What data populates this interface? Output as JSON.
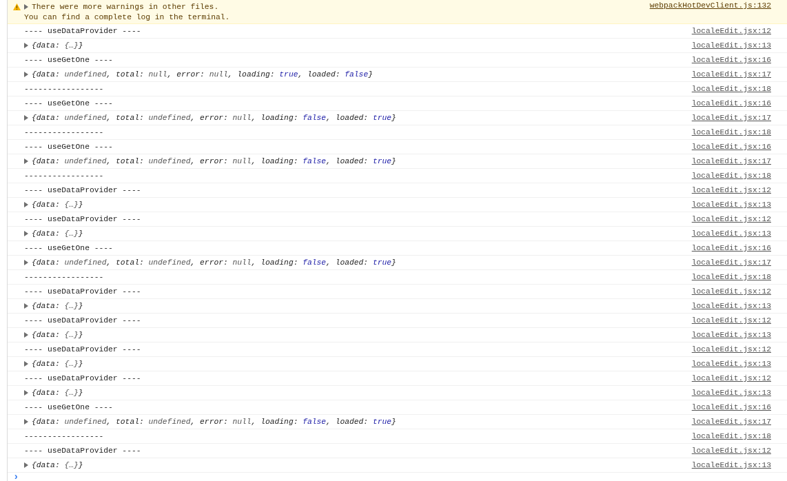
{
  "warning": {
    "expanded": false,
    "lines": [
      "There were more warnings in other files.",
      "You can find a complete log in the terminal."
    ],
    "source": "webpackHotDevClient.js:132"
  },
  "log": [
    {
      "kind": "text",
      "text": "---- useDataProvider ----",
      "source": "localeEdit.jsx:12"
    },
    {
      "kind": "object",
      "expanded": false,
      "parts": [
        {
          "text": "{data: ",
          "kind": "key"
        },
        {
          "text": "{…}",
          "kind": "value"
        },
        {
          "text": "}",
          "kind": "key"
        }
      ],
      "source": "localeEdit.jsx:13"
    },
    {
      "kind": "text",
      "text": "---- useGetOne ----",
      "source": "localeEdit.jsx:16"
    },
    {
      "kind": "object",
      "expanded": false,
      "parts": [
        {
          "text": "{data: ",
          "kind": "key"
        },
        {
          "text": "undefined",
          "kind": "value"
        },
        {
          "text": ", total: ",
          "kind": "key"
        },
        {
          "text": "null",
          "kind": "value"
        },
        {
          "text": ", error: ",
          "kind": "key"
        },
        {
          "text": "null",
          "kind": "value"
        },
        {
          "text": ", loading: ",
          "kind": "key"
        },
        {
          "text": "true",
          "kind": "boolean"
        },
        {
          "text": ", loaded: ",
          "kind": "key"
        },
        {
          "text": "false",
          "kind": "boolean"
        },
        {
          "text": "}",
          "kind": "key"
        }
      ],
      "source": "localeEdit.jsx:17"
    },
    {
      "kind": "text",
      "text": "-----------------",
      "source": "localeEdit.jsx:18"
    },
    {
      "kind": "text",
      "text": "---- useGetOne ----",
      "source": "localeEdit.jsx:16"
    },
    {
      "kind": "object",
      "expanded": false,
      "parts": [
        {
          "text": "{data: ",
          "kind": "key"
        },
        {
          "text": "undefined",
          "kind": "value"
        },
        {
          "text": ", total: ",
          "kind": "key"
        },
        {
          "text": "undefined",
          "kind": "value"
        },
        {
          "text": ", error: ",
          "kind": "key"
        },
        {
          "text": "null",
          "kind": "value"
        },
        {
          "text": ", loading: ",
          "kind": "key"
        },
        {
          "text": "false",
          "kind": "boolean"
        },
        {
          "text": ", loaded: ",
          "kind": "key"
        },
        {
          "text": "true",
          "kind": "boolean"
        },
        {
          "text": "}",
          "kind": "key"
        }
      ],
      "source": "localeEdit.jsx:17"
    },
    {
      "kind": "text",
      "text": "-----------------",
      "source": "localeEdit.jsx:18"
    },
    {
      "kind": "text",
      "text": "---- useGetOne ----",
      "source": "localeEdit.jsx:16"
    },
    {
      "kind": "object",
      "expanded": false,
      "parts": [
        {
          "text": "{data: ",
          "kind": "key"
        },
        {
          "text": "undefined",
          "kind": "value"
        },
        {
          "text": ", total: ",
          "kind": "key"
        },
        {
          "text": "undefined",
          "kind": "value"
        },
        {
          "text": ", error: ",
          "kind": "key"
        },
        {
          "text": "null",
          "kind": "value"
        },
        {
          "text": ", loading: ",
          "kind": "key"
        },
        {
          "text": "false",
          "kind": "boolean"
        },
        {
          "text": ", loaded: ",
          "kind": "key"
        },
        {
          "text": "true",
          "kind": "boolean"
        },
        {
          "text": "}",
          "kind": "key"
        }
      ],
      "source": "localeEdit.jsx:17"
    },
    {
      "kind": "text",
      "text": "-----------------",
      "source": "localeEdit.jsx:18"
    },
    {
      "kind": "text",
      "text": "---- useDataProvider ----",
      "source": "localeEdit.jsx:12"
    },
    {
      "kind": "object",
      "expanded": false,
      "parts": [
        {
          "text": "{data: ",
          "kind": "key"
        },
        {
          "text": "{…}",
          "kind": "value"
        },
        {
          "text": "}",
          "kind": "key"
        }
      ],
      "source": "localeEdit.jsx:13"
    },
    {
      "kind": "text",
      "text": "---- useDataProvider ----",
      "source": "localeEdit.jsx:12"
    },
    {
      "kind": "object",
      "expanded": false,
      "parts": [
        {
          "text": "{data: ",
          "kind": "key"
        },
        {
          "text": "{…}",
          "kind": "value"
        },
        {
          "text": "}",
          "kind": "key"
        }
      ],
      "source": "localeEdit.jsx:13"
    },
    {
      "kind": "text",
      "text": "---- useGetOne ----",
      "source": "localeEdit.jsx:16"
    },
    {
      "kind": "object",
      "expanded": false,
      "parts": [
        {
          "text": "{data: ",
          "kind": "key"
        },
        {
          "text": "undefined",
          "kind": "value"
        },
        {
          "text": ", total: ",
          "kind": "key"
        },
        {
          "text": "undefined",
          "kind": "value"
        },
        {
          "text": ", error: ",
          "kind": "key"
        },
        {
          "text": "null",
          "kind": "value"
        },
        {
          "text": ", loading: ",
          "kind": "key"
        },
        {
          "text": "false",
          "kind": "boolean"
        },
        {
          "text": ", loaded: ",
          "kind": "key"
        },
        {
          "text": "true",
          "kind": "boolean"
        },
        {
          "text": "}",
          "kind": "key"
        }
      ],
      "source": "localeEdit.jsx:17"
    },
    {
      "kind": "text",
      "text": "-----------------",
      "source": "localeEdit.jsx:18"
    },
    {
      "kind": "text",
      "text": "---- useDataProvider ----",
      "source": "localeEdit.jsx:12"
    },
    {
      "kind": "object",
      "expanded": false,
      "parts": [
        {
          "text": "{data: ",
          "kind": "key"
        },
        {
          "text": "{…}",
          "kind": "value"
        },
        {
          "text": "}",
          "kind": "key"
        }
      ],
      "source": "localeEdit.jsx:13"
    },
    {
      "kind": "text",
      "text": "---- useDataProvider ----",
      "source": "localeEdit.jsx:12"
    },
    {
      "kind": "object",
      "expanded": false,
      "parts": [
        {
          "text": "{data: ",
          "kind": "key"
        },
        {
          "text": "{…}",
          "kind": "value"
        },
        {
          "text": "}",
          "kind": "key"
        }
      ],
      "source": "localeEdit.jsx:13"
    },
    {
      "kind": "text",
      "text": "---- useDataProvider ----",
      "source": "localeEdit.jsx:12"
    },
    {
      "kind": "object",
      "expanded": false,
      "parts": [
        {
          "text": "{data: ",
          "kind": "key"
        },
        {
          "text": "{…}",
          "kind": "value"
        },
        {
          "text": "}",
          "kind": "key"
        }
      ],
      "source": "localeEdit.jsx:13"
    },
    {
      "kind": "text",
      "text": "---- useDataProvider ----",
      "source": "localeEdit.jsx:12"
    },
    {
      "kind": "object",
      "expanded": false,
      "parts": [
        {
          "text": "{data: ",
          "kind": "key"
        },
        {
          "text": "{…}",
          "kind": "value"
        },
        {
          "text": "}",
          "kind": "key"
        }
      ],
      "source": "localeEdit.jsx:13"
    },
    {
      "kind": "text",
      "text": "---- useGetOne ----",
      "source": "localeEdit.jsx:16"
    },
    {
      "kind": "object",
      "expanded": false,
      "parts": [
        {
          "text": "{data: ",
          "kind": "key"
        },
        {
          "text": "undefined",
          "kind": "value"
        },
        {
          "text": ", total: ",
          "kind": "key"
        },
        {
          "text": "undefined",
          "kind": "value"
        },
        {
          "text": ", error: ",
          "kind": "key"
        },
        {
          "text": "null",
          "kind": "value"
        },
        {
          "text": ", loading: ",
          "kind": "key"
        },
        {
          "text": "false",
          "kind": "boolean"
        },
        {
          "text": ", loaded: ",
          "kind": "key"
        },
        {
          "text": "true",
          "kind": "boolean"
        },
        {
          "text": "}",
          "kind": "key"
        }
      ],
      "source": "localeEdit.jsx:17"
    },
    {
      "kind": "text",
      "text": "-----------------",
      "source": "localeEdit.jsx:18"
    },
    {
      "kind": "text",
      "text": "---- useDataProvider ----",
      "source": "localeEdit.jsx:12"
    },
    {
      "kind": "object",
      "expanded": false,
      "parts": [
        {
          "text": "{data: ",
          "kind": "key"
        },
        {
          "text": "{…}",
          "kind": "value"
        },
        {
          "text": "}",
          "kind": "key"
        }
      ],
      "source": "localeEdit.jsx:13"
    }
  ],
  "prompt": {
    "symbol": "›"
  }
}
